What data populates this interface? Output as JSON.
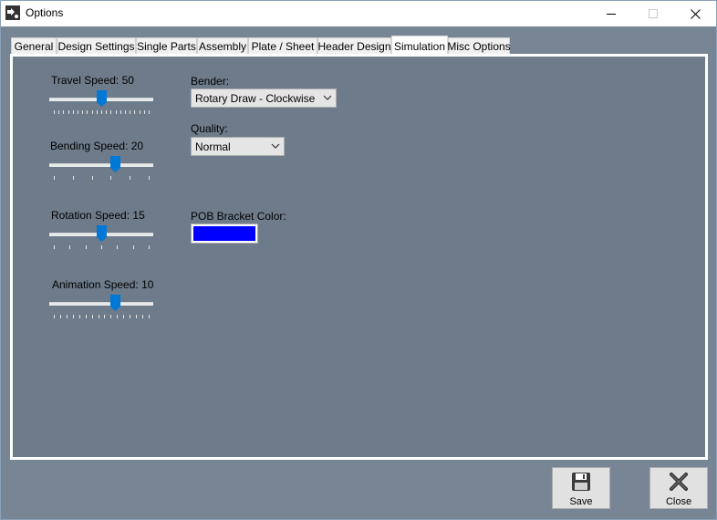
{
  "window": {
    "title": "Options",
    "icon": "app-logo-icon"
  },
  "tabs": [
    {
      "label": "General"
    },
    {
      "label": "Design Settings"
    },
    {
      "label": "Single Parts"
    },
    {
      "label": "Assembly"
    },
    {
      "label": "Plate / Sheet"
    },
    {
      "label": "Header Design"
    },
    {
      "label": "Simulation",
      "active": true
    },
    {
      "label": "Misc Options"
    }
  ],
  "sliders": {
    "travel": {
      "label": "Travel Speed: 50",
      "value": 50,
      "level": 0.5
    },
    "bending": {
      "label": "Bending Speed: 20",
      "value": 20,
      "level": 0.65
    },
    "rotation": {
      "label": "Rotation Speed: 15",
      "value": 15,
      "level": 0.5
    },
    "animation": {
      "label": "Animation Speed: 10",
      "value": 10,
      "level": 0.65
    }
  },
  "bender": {
    "label": "Bender:",
    "selected": "Rotary Draw - Clockwise"
  },
  "quality": {
    "label": "Quality:",
    "selected": "Normal"
  },
  "pob_bracket_color": {
    "label": "POB Bracket Color:",
    "color": "#0000ff"
  },
  "buttons": {
    "save": {
      "label": "Save",
      "icon": "save-icon"
    },
    "close": {
      "label": "Close",
      "icon": "close-x-icon"
    }
  },
  "colors": {
    "window_bg": "#778595",
    "tabpage_bg": "#6d7b8b",
    "slider_thumb": "#0078d7"
  }
}
